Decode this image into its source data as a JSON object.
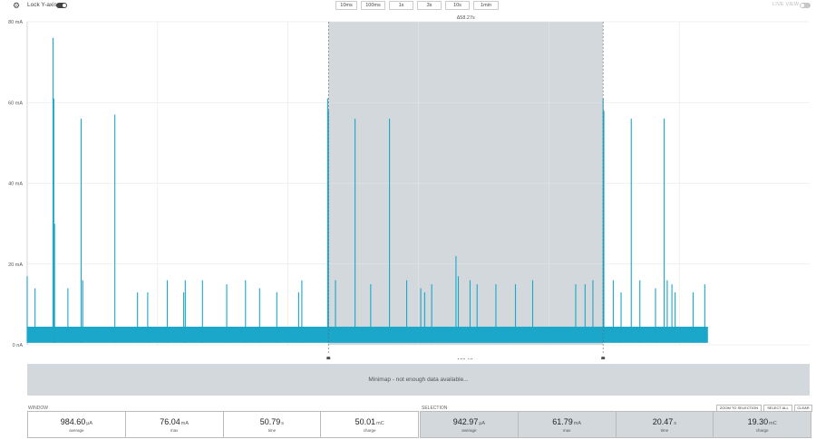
{
  "toolbar": {
    "lock_label": "Lock Y-axis",
    "lock_on": true,
    "live_label": "LIVE VIEW",
    "live_on": false,
    "zoom_buttons": [
      "10ms",
      "100ms",
      "1s",
      "3s",
      "10s",
      "1min"
    ]
  },
  "chart_data": {
    "type": "line",
    "y_ticks": [
      "80 mA",
      "60 mA",
      "40 mA",
      "20 mA",
      "0 nA"
    ],
    "ylim": [
      0,
      80
    ],
    "y_unit": "mA",
    "baseline_range": [
      0.5,
      4.5
    ],
    "data_end_fraction": 0.87,
    "spikes": [
      {
        "x": 0.0,
        "y": 17
      },
      {
        "x": 0.01,
        "y": 14
      },
      {
        "x": 0.033,
        "y": 76
      },
      {
        "x": 0.034,
        "y": 61
      },
      {
        "x": 0.035,
        "y": 30
      },
      {
        "x": 0.052,
        "y": 14
      },
      {
        "x": 0.069,
        "y": 56
      },
      {
        "x": 0.071,
        "y": 16
      },
      {
        "x": 0.112,
        "y": 57
      },
      {
        "x": 0.141,
        "y": 13
      },
      {
        "x": 0.154,
        "y": 13
      },
      {
        "x": 0.179,
        "y": 16
      },
      {
        "x": 0.2,
        "y": 13
      },
      {
        "x": 0.202,
        "y": 16
      },
      {
        "x": 0.224,
        "y": 16
      },
      {
        "x": 0.255,
        "y": 15
      },
      {
        "x": 0.279,
        "y": 16
      },
      {
        "x": 0.297,
        "y": 14
      },
      {
        "x": 0.319,
        "y": 13
      },
      {
        "x": 0.351,
        "y": 16
      },
      {
        "x": 0.347,
        "y": 13
      },
      {
        "x": 0.384,
        "y": 61
      },
      {
        "x": 0.385,
        "y": 58
      },
      {
        "x": 0.394,
        "y": 16
      },
      {
        "x": 0.419,
        "y": 56
      },
      {
        "x": 0.439,
        "y": 15
      },
      {
        "x": 0.463,
        "y": 56
      },
      {
        "x": 0.485,
        "y": 16
      },
      {
        "x": 0.503,
        "y": 14
      },
      {
        "x": 0.508,
        "y": 13
      },
      {
        "x": 0.517,
        "y": 15
      },
      {
        "x": 0.548,
        "y": 22
      },
      {
        "x": 0.551,
        "y": 17
      },
      {
        "x": 0.566,
        "y": 16
      },
      {
        "x": 0.575,
        "y": 15
      },
      {
        "x": 0.599,
        "y": 15
      },
      {
        "x": 0.624,
        "y": 15
      },
      {
        "x": 0.646,
        "y": 16
      },
      {
        "x": 0.701,
        "y": 15
      },
      {
        "x": 0.713,
        "y": 15
      },
      {
        "x": 0.723,
        "y": 16
      },
      {
        "x": 0.736,
        "y": 61
      },
      {
        "x": 0.737,
        "y": 58
      },
      {
        "x": 0.749,
        "y": 16
      },
      {
        "x": 0.759,
        "y": 13
      },
      {
        "x": 0.772,
        "y": 56
      },
      {
        "x": 0.783,
        "y": 16
      },
      {
        "x": 0.803,
        "y": 14
      },
      {
        "x": 0.818,
        "y": 16
      },
      {
        "x": 0.814,
        "y": 56
      },
      {
        "x": 0.824,
        "y": 15
      },
      {
        "x": 0.828,
        "y": 13
      },
      {
        "x": 0.851,
        "y": 13
      },
      {
        "x": 0.866,
        "y": 15
      }
    ],
    "selection": {
      "start": 0.385,
      "end": 0.736
    },
    "selection_top_label": "Δ58.27s",
    "selection_bottom_label": "Δ20.47s"
  },
  "minimap": {
    "text": "Minimap - not enough data available..."
  },
  "window": {
    "label": "WINDOW",
    "stats": [
      {
        "value": "984.60",
        "unit": "μA",
        "label": "average"
      },
      {
        "value": "76.04",
        "unit": "mA",
        "label": "max"
      },
      {
        "value": "50.79",
        "unit": "s",
        "label": "time"
      },
      {
        "value": "50.01",
        "unit": "mC",
        "label": "charge"
      }
    ]
  },
  "selection": {
    "label": "SELECTION",
    "buttons": {
      "zoom": "ZOOM TO SELECTION",
      "select_all": "SELECT ALL",
      "clear": "CLEAR"
    },
    "stats": [
      {
        "value": "942.97",
        "unit": "μA",
        "label": "average"
      },
      {
        "value": "61.79",
        "unit": "mA",
        "label": "max"
      },
      {
        "value": "20.47",
        "unit": "s",
        "label": "time"
      },
      {
        "value": "19.30",
        "unit": "mC",
        "label": "charge"
      }
    ]
  },
  "colors": {
    "trace": "#1aa7c9",
    "selection_fill": "#d2d8dc",
    "grid": "#e6e6e6"
  }
}
